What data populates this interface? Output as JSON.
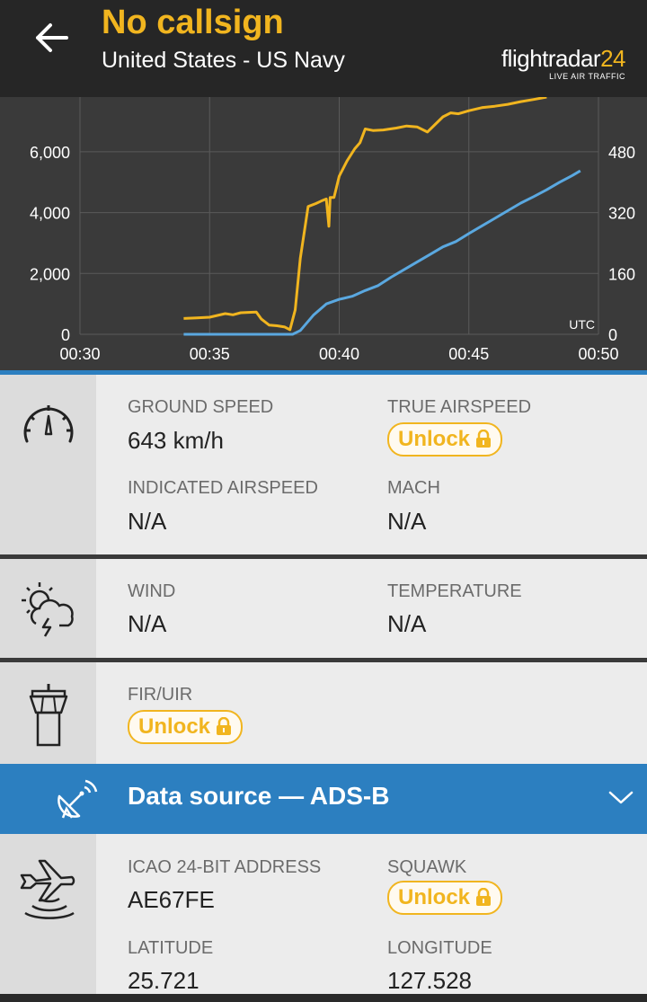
{
  "header": {
    "back_icon": "arrow-left-icon",
    "title": "No callsign",
    "subtitle": "United States - US Navy",
    "brand_name": "flightradar",
    "brand_num": "24",
    "brand_tag": "LIVE AIR TRAFFIC"
  },
  "colors": {
    "accent_yellow": "#f1b51f",
    "accent_blue": "#2c7fc0",
    "series_blue": "#5aa8e0",
    "header_bg": "#262626",
    "chart_bg": "#3a3a3a"
  },
  "chart_data": {
    "type": "line",
    "x_tick_labels": [
      "00:30",
      "00:35",
      "00:40",
      "00:45",
      "00:50"
    ],
    "x_unit_label": "UTC",
    "y_left_ticks": [
      {
        "value": 0,
        "label": "0"
      },
      {
        "value": 2000,
        "label": "2,000"
      },
      {
        "value": 4000,
        "label": "4,000"
      },
      {
        "value": 6000,
        "label": "6,000"
      }
    ],
    "y_right_ticks": [
      {
        "value": 0,
        "label": "0"
      },
      {
        "value": 160,
        "label": "160"
      },
      {
        "value": 320,
        "label": "320"
      },
      {
        "value": 480,
        "label": "480"
      }
    ],
    "xlim_minutes": [
      30,
      50
    ],
    "ylim_left": [
      0,
      7800
    ],
    "ylim_right": [
      0,
      624
    ],
    "grid": true,
    "series": [
      {
        "axis": "left",
        "color": "#f1b51f",
        "points": [
          [
            34.0,
            520
          ],
          [
            34.5,
            540
          ],
          [
            35.0,
            560
          ],
          [
            35.3,
            620
          ],
          [
            35.6,
            680
          ],
          [
            35.9,
            640
          ],
          [
            36.2,
            710
          ],
          [
            36.5,
            720
          ],
          [
            36.8,
            730
          ],
          [
            37.0,
            500
          ],
          [
            37.3,
            300
          ],
          [
            37.6,
            280
          ],
          [
            37.9,
            240
          ],
          [
            38.1,
            150
          ],
          [
            38.3,
            800
          ],
          [
            38.5,
            2500
          ],
          [
            38.8,
            4200
          ],
          [
            39.1,
            4300
          ],
          [
            39.3,
            4380
          ],
          [
            39.5,
            4450
          ],
          [
            39.6,
            3550
          ],
          [
            39.65,
            4500
          ],
          [
            39.8,
            4500
          ],
          [
            40.0,
            5200
          ],
          [
            40.3,
            5700
          ],
          [
            40.6,
            6100
          ],
          [
            40.8,
            6300
          ],
          [
            41.0,
            6750
          ],
          [
            41.3,
            6700
          ],
          [
            41.7,
            6720
          ],
          [
            42.2,
            6780
          ],
          [
            42.6,
            6850
          ],
          [
            43.0,
            6820
          ],
          [
            43.4,
            6650
          ],
          [
            43.7,
            6900
          ],
          [
            44.0,
            7150
          ],
          [
            44.3,
            7280
          ],
          [
            44.6,
            7250
          ],
          [
            45.0,
            7350
          ],
          [
            45.5,
            7450
          ],
          [
            46.0,
            7500
          ],
          [
            46.5,
            7560
          ],
          [
            47.0,
            7650
          ],
          [
            47.5,
            7720
          ],
          [
            48.0,
            7800
          ]
        ]
      },
      {
        "axis": "right",
        "color": "#5aa8e0",
        "points": [
          [
            34.0,
            0
          ],
          [
            36.0,
            0
          ],
          [
            38.2,
            0
          ],
          [
            38.5,
            10
          ],
          [
            39.0,
            50
          ],
          [
            39.5,
            80
          ],
          [
            40.0,
            92
          ],
          [
            40.5,
            100
          ],
          [
            41.0,
            115
          ],
          [
            41.5,
            128
          ],
          [
            42.0,
            150
          ],
          [
            42.5,
            170
          ],
          [
            43.0,
            190
          ],
          [
            43.5,
            210
          ],
          [
            44.0,
            230
          ],
          [
            44.5,
            244
          ],
          [
            45.0,
            265
          ],
          [
            45.5,
            285
          ],
          [
            46.0,
            305
          ],
          [
            46.5,
            325
          ],
          [
            47.0,
            345
          ],
          [
            47.5,
            362
          ],
          [
            48.0,
            380
          ],
          [
            48.5,
            400
          ],
          [
            49.0,
            418
          ],
          [
            49.3,
            430
          ]
        ]
      }
    ]
  },
  "speed": {
    "icon": "speedometer-icon",
    "ground_speed_label": "GROUND SPEED",
    "ground_speed_value": "643 km/h",
    "true_airspeed_label": "TRUE AIRSPEED",
    "true_airspeed_unlock": "Unlock",
    "indicated_airspeed_label": "INDICATED AIRSPEED",
    "indicated_airspeed_value": "N/A",
    "mach_label": "MACH",
    "mach_value": "N/A"
  },
  "weather": {
    "icon": "weather-icon",
    "wind_label": "WIND",
    "wind_value": "N/A",
    "temperature_label": "TEMPERATURE",
    "temperature_value": "N/A"
  },
  "fir": {
    "icon": "control-tower-icon",
    "fir_label": "FIR/UIR",
    "fir_unlock": "Unlock"
  },
  "data_source": {
    "icon": "satellite-dish-icon",
    "label": "Data source — ADS-B",
    "chevron_icon": "chevron-down-icon"
  },
  "ads": {
    "icon": "aircraft-signal-icon",
    "icao_label": "ICAO 24-BIT ADDRESS",
    "icao_value": "AE67FE",
    "squawk_label": "SQUAWK",
    "squawk_unlock": "Unlock",
    "latitude_label": "LATITUDE",
    "latitude_value": "25.721",
    "longitude_label": "LONGITUDE",
    "longitude_value": "127.528"
  }
}
